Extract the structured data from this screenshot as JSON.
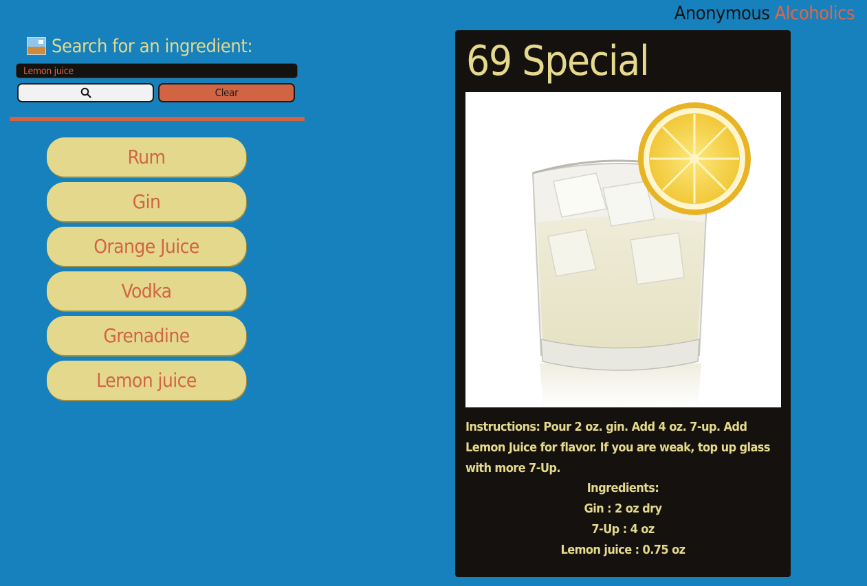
{
  "brand": {
    "name_part1": "Anonymous",
    "name_part2": "Alcoholics"
  },
  "search": {
    "heading": "Search for an ingredient:",
    "input_value": "Lemon juice",
    "clear_label": "Clear"
  },
  "ingredients": [
    {
      "label": "Rum"
    },
    {
      "label": "Gin"
    },
    {
      "label": "Orange Juice"
    },
    {
      "label": "Vodka"
    },
    {
      "label": "Grenadine"
    },
    {
      "label": "Lemon juice"
    }
  ],
  "drink": {
    "name": "69 Special",
    "instructions": "Instructions: Pour 2 oz. gin. Add 4 oz. 7-up. Add Lemon Juice for flavor. If you are weak, top up glass with more 7-Up.",
    "ingredients_heading": "Ingredients:",
    "ingredients": [
      "Gin : 2 oz dry",
      "7-Up : 4 oz",
      "Lemon juice : 0.75 oz"
    ]
  },
  "colors": {
    "background": "#1681bd",
    "accent_orange": "#d16543",
    "button_yellow": "#e3d88c",
    "card_dark": "#15110e"
  },
  "icons": [
    "image-icon",
    "search-icon"
  ]
}
